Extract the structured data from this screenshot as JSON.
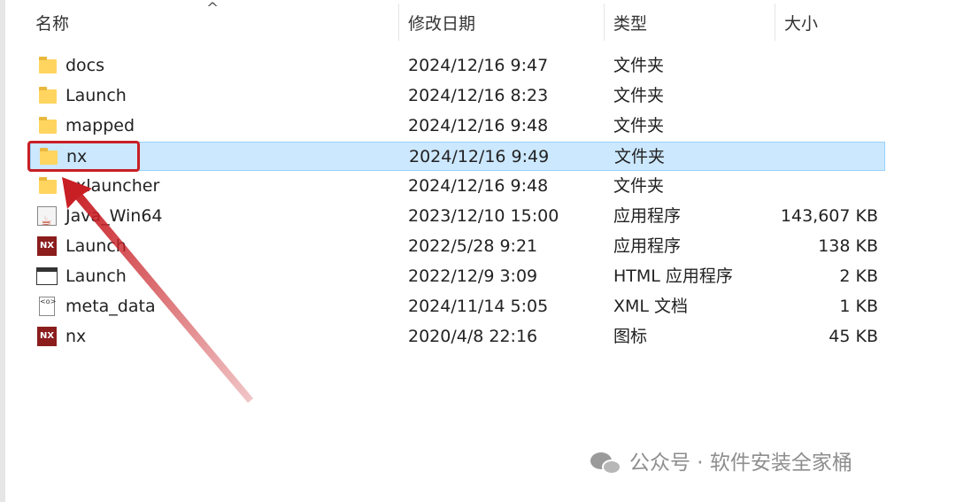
{
  "columns": {
    "name": "名称",
    "date": "修改日期",
    "type": "类型",
    "size": "大小"
  },
  "files": [
    {
      "name": "docs",
      "date": "2024/12/16 9:47",
      "type": "文件夹",
      "size": "",
      "icon": "folder-icon"
    },
    {
      "name": "Launch",
      "date": "2024/12/16 8:23",
      "type": "文件夹",
      "size": "",
      "icon": "folder-icon"
    },
    {
      "name": "mapped",
      "date": "2024/12/16 9:48",
      "type": "文件夹",
      "size": "",
      "icon": "folder-icon"
    },
    {
      "name": "nx",
      "date": "2024/12/16 9:49",
      "type": "文件夹",
      "size": "",
      "icon": "folder-icon",
      "selected": true
    },
    {
      "name": "nxlauncher",
      "date": "2024/12/16 9:48",
      "type": "文件夹",
      "size": "",
      "icon": "folder-icon"
    },
    {
      "name": "Java_Win64",
      "date": "2023/12/10 15:00",
      "type": "应用程序",
      "size": "143,607 KB",
      "icon": "java-app-icon"
    },
    {
      "name": "Launch",
      "date": "2022/5/28 9:21",
      "type": "应用程序",
      "size": "138 KB",
      "icon": "nx-app-icon"
    },
    {
      "name": "Launch",
      "date": "2022/12/9 3:09",
      "type": "HTML 应用程序",
      "size": "2 KB",
      "icon": "html-app-icon"
    },
    {
      "name": "meta_data",
      "date": "2024/11/14 5:05",
      "type": "XML 文档",
      "size": "1 KB",
      "icon": "xml-document-icon"
    },
    {
      "name": "nx",
      "date": "2020/4/8 22:16",
      "type": "图标",
      "size": "45 KB",
      "icon": "nx-icon-file-icon"
    }
  ],
  "icon_labels": {
    "nx": "NX",
    "xml": "<o>"
  },
  "annotation": {
    "color": "#c81f25"
  },
  "watermark": {
    "text": "公众号 · 软件安装全家桶",
    "icon": "wechat-icon"
  }
}
